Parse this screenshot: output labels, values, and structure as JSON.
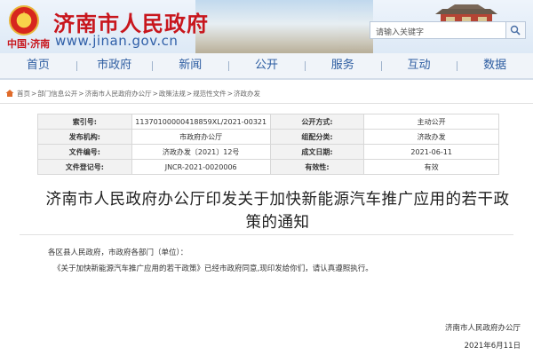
{
  "header": {
    "site_title": "济南市人民政府",
    "slogan": "中国·济南",
    "url": "www.jinan.gov.cn",
    "search_placeholder": "请输入关键字"
  },
  "nav": [
    "首页",
    "市政府",
    "新闻",
    "公开",
    "服务",
    "互动",
    "数据"
  ],
  "breadcrumb": [
    "首页",
    "部门信息公开",
    "济南市人民政府办公厅",
    "政策法规",
    "规范性文件",
    "济政办发"
  ],
  "meta": {
    "rows": [
      [
        "索引号:",
        "11370100000418859XL/2021-00321",
        "公开方式:",
        "主动公开"
      ],
      [
        "发布机构:",
        "市政府办公厅",
        "组配分类:",
        "济政办发"
      ],
      [
        "文件编号:",
        "济政办发〔2021〕12号",
        "成文日期:",
        "2021-06-11"
      ],
      [
        "文件登记号:",
        "JNCR-2021-0020006",
        "有效性:",
        "有效"
      ]
    ]
  },
  "article": {
    "title": "济南市人民政府办公厅印发关于加快新能源汽车推广应用的若干政策的通知",
    "greeting": "各区县人民政府，市政府各部门（单位）：",
    "body": "《关于加快新能源汽车推广应用的若干政策》已经市政府同意,现印发给你们，请认真遵照执行。",
    "signature_org": "济南市人民政府办公厅",
    "signature_date": "2021年6月11日"
  },
  "colors": {
    "brand_red": "#c8161d",
    "nav_blue": "#2d5da1"
  }
}
